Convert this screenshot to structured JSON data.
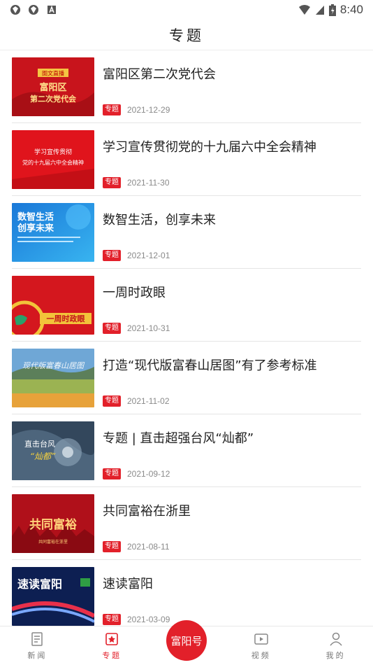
{
  "status_bar": {
    "time": "8:40"
  },
  "header": {
    "title": "专题"
  },
  "items": [
    {
      "title": "富阳区第二次党代会",
      "tag": "专题",
      "date": "2021-12-29",
      "thumb_text": [
        "图文直播",
        "富阳区",
        "第二次党代会"
      ]
    },
    {
      "title": "学习宣传贯彻党的十九届六中全会精神",
      "tag": "专题",
      "date": "2021-11-30",
      "thumb_text": [
        "学习宣传贯彻",
        "党的十九届六中全会精神"
      ]
    },
    {
      "title": "数智生活，创享未来",
      "tag": "专题",
      "date": "2021-12-01",
      "thumb_text": [
        "数智生活",
        "创享未来"
      ]
    },
    {
      "title": "一周时政眼",
      "tag": "专题",
      "date": "2021-10-31",
      "thumb_text": [
        "一周时政眼"
      ]
    },
    {
      "title": "打造“现代版富春山居图”有了参考标准",
      "tag": "专题",
      "date": "2021-11-02",
      "thumb_text": [
        "现代版富春山居图"
      ]
    },
    {
      "title": "专题 | 直击超强台风“灿都”",
      "tag": "专题",
      "date": "2021-09-12",
      "thumb_text": [
        "直击台风",
        "“灿都”"
      ]
    },
    {
      "title": "共同富裕在浙里",
      "tag": "专题",
      "date": "2021-08-11",
      "thumb_text": [
        "共同富裕",
        "共同富裕在浙里"
      ]
    },
    {
      "title": "速读富阳",
      "tag": "专题",
      "date": "2021-03-09",
      "thumb_text": [
        "速读富阳"
      ]
    }
  ],
  "nav": {
    "news": "新闻",
    "topics": "专题",
    "center": "富阳号",
    "video": "视频",
    "mine": "我的"
  },
  "colors": {
    "accent": "#e2202a"
  }
}
